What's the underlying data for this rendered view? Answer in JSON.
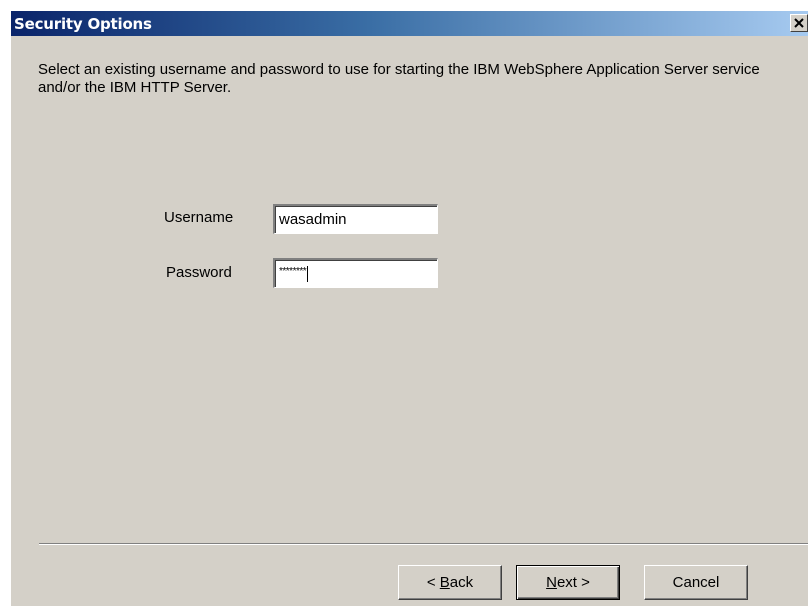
{
  "window": {
    "title": "Security Options",
    "close_glyph": "✕"
  },
  "instructions": "Select an existing username and password to use for starting the IBM WebSphere Application Server service and/or the IBM HTTP Server.",
  "form": {
    "username_label": "Username",
    "username_value": "wasadmin",
    "password_label": "Password",
    "password_value": "********"
  },
  "buttons": {
    "back_prefix": "< ",
    "back_mnemonic": "B",
    "back_rest": "ack",
    "next_mnemonic": "N",
    "next_rest": "ext >",
    "cancel_label": "Cancel"
  },
  "icons": {
    "close": "close-icon"
  },
  "colors": {
    "titlebar_start": "#0a246a",
    "titlebar_end": "#a6caf0",
    "dialog_face": "#d4d0c8"
  }
}
